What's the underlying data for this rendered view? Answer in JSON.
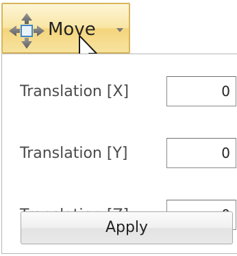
{
  "toolbar": {
    "move_button": {
      "label": "Move",
      "icon": "move-arrows-icon",
      "dropdown_icon": "chevron-down-icon"
    }
  },
  "panel": {
    "rows": [
      {
        "label": "Translation [X]",
        "value": "0"
      },
      {
        "label": "Translation [Y]",
        "value": "0"
      },
      {
        "label": "Translation [Z]",
        "value": "0"
      }
    ],
    "apply_label": "Apply"
  },
  "colors": {
    "button_highlight": "#f9e6a6",
    "button_border": "#d8b55a",
    "move_icon": "#5a9cd6"
  }
}
